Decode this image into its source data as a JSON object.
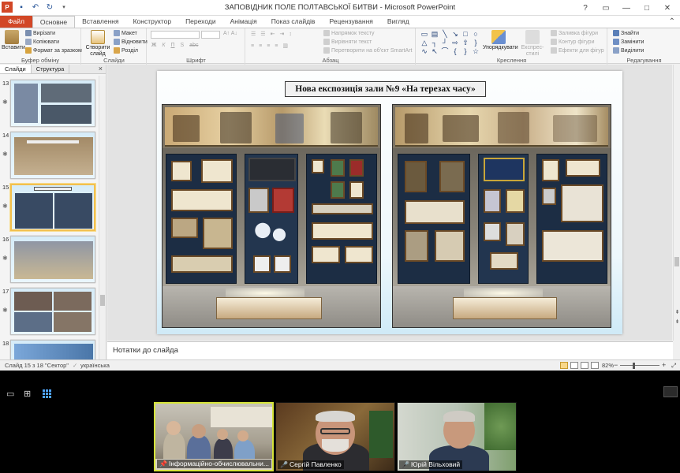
{
  "window": {
    "title": "ЗАПОВІДНИК ПОЛЕ ПОЛТАВСЬКОЇ БИТВИ - Microsoft PowerPoint",
    "controls": [
      "?",
      "▭",
      "—",
      "□",
      "✕"
    ]
  },
  "tabs": [
    "Файл",
    "Основне",
    "Вставлення",
    "Конструктор",
    "Переходи",
    "Анімація",
    "Показ слайдів",
    "Рецензування",
    "Вигляд"
  ],
  "active_tab": "Основне",
  "ribbon": {
    "clipboard": {
      "paste": "Вставити",
      "cut": "Вирізати",
      "copy": "Копіювати",
      "format": "Формат за зразком",
      "label": "Буфер обміну"
    },
    "slides": {
      "new": "Створити слайд",
      "layout": "Макет",
      "reset": "Відновити",
      "section": "Розділ",
      "label": "Слайди"
    },
    "font": {
      "label": "Шрифт",
      "buttons": [
        "Ж",
        "К",
        "П",
        "S",
        "abc"
      ]
    },
    "paragraph": {
      "direction": "Напрямок тексту",
      "align": "Вирівняти текст",
      "smartart": "Перетворити на об'єкт SmartArt",
      "label": "Абзац"
    },
    "drawing": {
      "arrange": "Упорядкувати",
      "quick_styles": "Експрес-стилі",
      "fill": "Заливка фігури",
      "outline": "Контур фігури",
      "effects": "Ефекти для фігур",
      "label": "Креслення"
    },
    "editing": {
      "find": "Знайти",
      "replace": "Замінити",
      "select": "Виділити",
      "label": "Редагування"
    }
  },
  "left_pane": {
    "tabs": [
      "Слайди",
      "Структура"
    ],
    "close": "×",
    "slides": [
      {
        "num": "13"
      },
      {
        "num": "14"
      },
      {
        "num": "15",
        "selected": true
      },
      {
        "num": "16"
      },
      {
        "num": "17"
      },
      {
        "num": "18"
      }
    ]
  },
  "slide": {
    "title": "Нова експозиція зали №9 «На терезах часу»"
  },
  "notes": {
    "placeholder": "Нотатки до слайда"
  },
  "status": {
    "slide_info": "Слайд 15 з 18",
    "theme": "\"Сектор\"",
    "language": "українська",
    "zoom": "82%",
    "zoom_fraction": 0.32
  },
  "meeting": {
    "participants": [
      {
        "name": "Інформаційно-обчислювальни...",
        "active": true
      },
      {
        "name": "Сергій Павленко",
        "active": false
      },
      {
        "name": "Юрій Вільховий",
        "active": false
      }
    ]
  },
  "colors": {
    "file_tab": "#d24726",
    "selection": "#f2c04e",
    "active_speaker": "#d6e43a"
  }
}
